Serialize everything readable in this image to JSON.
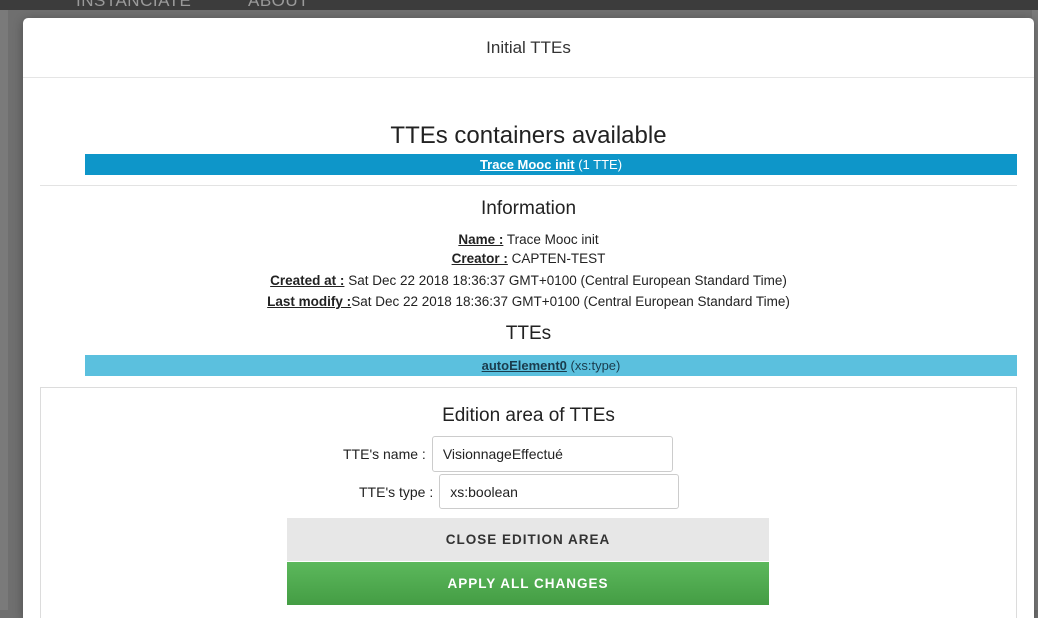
{
  "background_nav": {
    "items": [
      "INSTANCIATE",
      "ABOUT"
    ]
  },
  "modal": {
    "title": "Initial TTEs",
    "containers_heading": "TTEs containers available",
    "container": {
      "name": "Trace Mooc init",
      "count": "(1 TTE)"
    },
    "information": {
      "heading": "Information",
      "name_label": "Name :",
      "name_value": "Trace Mooc init",
      "creator_label": "Creator :",
      "creator_value": "CAPTEN-TEST",
      "created_label": "Created at :",
      "created_value": "Sat Dec 22 2018 18:36:37 GMT+0100 (Central European Standard Time)",
      "modified_label": "Last modify :",
      "modified_value": "Sat Dec 22 2018 18:36:37 GMT+0100 (Central European Standard Time)"
    },
    "ttes": {
      "heading": "TTEs",
      "item_name": "autoElement0",
      "item_type": "(xs:type)"
    },
    "edition": {
      "heading": "Edition area of TTEs",
      "name_label": "TTE's name :",
      "name_value": "VisionnageEffectué",
      "type_label": "TTE's type :",
      "type_value": "xs:boolean",
      "close_button": "CLOSE EDITION AREA",
      "apply_button": "APPLY ALL CHANGES"
    }
  },
  "colors": {
    "container_bar": "#0e96c9",
    "tte_bar": "#5bc0de",
    "apply_button": "#4cae4c",
    "close_button": "#e7e7e7"
  }
}
